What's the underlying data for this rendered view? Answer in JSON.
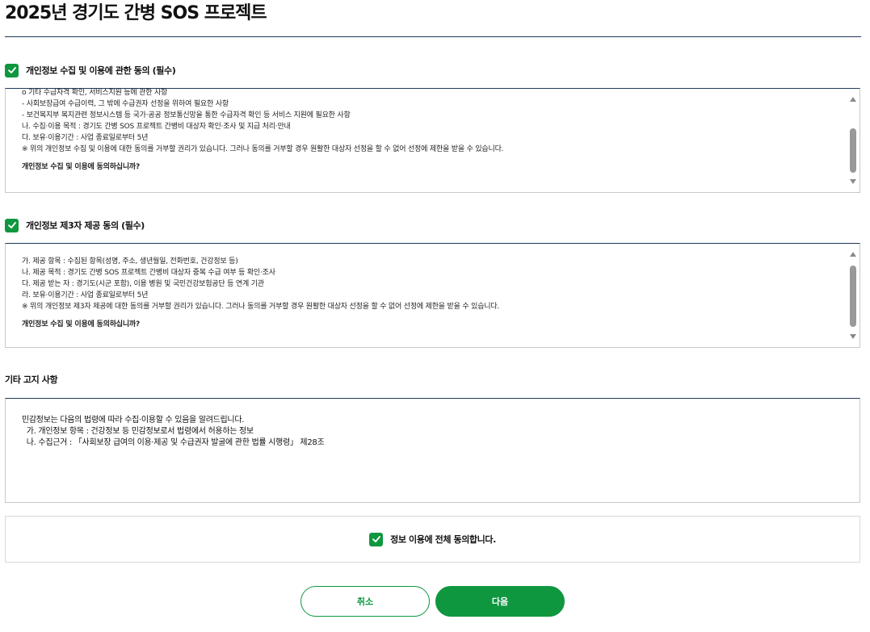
{
  "page": {
    "title": "2025년 경기도 간병 SOS 프로젝트"
  },
  "colors": {
    "accent": "#0f9740",
    "rule": "#1f3a5a"
  },
  "consent_collect": {
    "heading": "개인정보 수집 및 이용에 관한 동의 (필수)",
    "checked": true,
    "lines": [
      "o 기타 수급자격 확인, 서비스지원 등에 관한 사항",
      "- 사회보장급여 수급이력, 그 밖에 수급권자 선정을 위하여 필요한 사항",
      "- 보건복지부 복지관련 정보시스템 등 국가·공공 정보통신망을 통한 수급자격 확인 등 서비스 지원에 필요한 사항",
      "나. 수집·이용 목적 : 경기도 간병 SOS 프로젝트 간병비 대상자 확인·조사 및 지급 처리·안내",
      "다. 보유·이용기간 : 사업 종료일로부터 5년",
      "※ 위의 개인정보 수집 및 이용에 대한 동의를 거부할 권리가 있습니다. 그러나 동의를 거부할 경우 원활한 대상자 선정을 할 수 없어 선정에 제한을 받을 수 있습니다."
    ],
    "question": "개인정보 수집 및 이용에 동의하십니까?"
  },
  "consent_third_party": {
    "heading": "개인정보 제3자 제공 동의 (필수)",
    "checked": true,
    "lines": [
      "가. 제공 항목 : 수집된 항목(성명, 주소, 생년월일, 전화번호, 건강정보 등)",
      "나. 제공 목적 : 경기도 간병 SOS 프로젝트 간병비 대상자 중복 수급 여부 등 확인·조사",
      "다. 제공 받는 자 : 경기도(시군 포함), 이용 병원 및 국민건강보험공단 등 연계 기관",
      "라. 보유·이용기간 : 사업 종료일로부터 5년",
      "※ 위의 개인정보 제3자 제공에 대한 동의를 거부할 권리가 있습니다. 그러나 동의를 거부할 경우 원활한 대상자 선정을 할 수 없어 선정에 제한을 받을 수 있습니다."
    ],
    "question": "개인정보 수집 및 이용에 동의하십니까?"
  },
  "notice": {
    "heading": "기타 고지 사항",
    "lines": [
      "민감정보는 다음의 법령에 따라 수집·이용할 수 있음을 알려드립니다.",
      "  가. 개인정보 항목 : 건강정보 등 민감정보로서 법령에서 허용하는 정보",
      "  나. 수집근거 : 「사회보장 급여의 이용·제공 및 수급권자 발굴에 관한 법률 시행령」 제28조"
    ]
  },
  "agree_all": {
    "label": "정보 이용에 전체 동의합니다.",
    "checked": true
  },
  "buttons": {
    "cancel": "취소",
    "next": "다음"
  },
  "icons": {
    "checkbox": "check-icon",
    "scroll_up": "arrow-up-icon",
    "scroll_down": "arrow-down-icon"
  }
}
